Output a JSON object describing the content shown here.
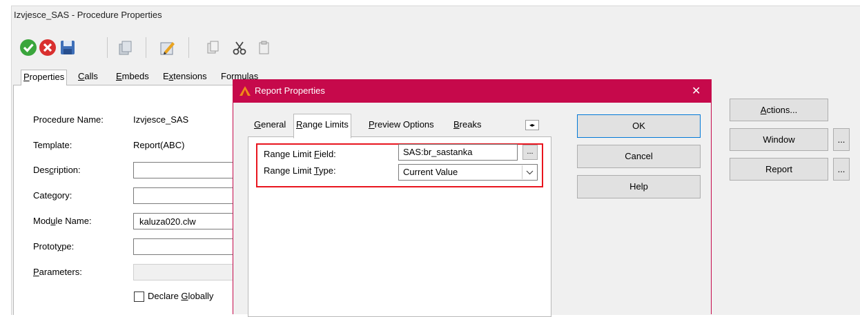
{
  "outer_window": {
    "title": "Izvjesce_SAS - Procedure Properties",
    "tabs": [
      {
        "label": "Properties",
        "ul": "P"
      },
      {
        "label": "Calls",
        "ul": "C"
      },
      {
        "label": "Embeds",
        "ul": "E"
      },
      {
        "label": "Extensions",
        "ul": "x"
      },
      {
        "label": "Formulas",
        "ul": "u"
      }
    ],
    "toolbar": [
      "ok-check-icon",
      "cancel-x-icon",
      "save-disk-icon",
      "copy-pages-icon",
      "edit-pencil-icon",
      "paste-icon",
      "cut-scissors-icon",
      "clipboard-icon"
    ],
    "fields": {
      "procedure_name_label": "Procedure Name:",
      "procedure_name_value": "Izvjesce_SAS",
      "template_label": "Template:",
      "template_value": "Report(ABC)",
      "description_label": "Description:",
      "category_label": "Category:",
      "module_name_label": "Module Name:",
      "module_name_value": "kaluza020.clw",
      "prototype_label": "Prototype:",
      "parameters_label": "Parameters:",
      "declare_globally_label": "Declare Globally"
    },
    "right_buttons": {
      "actions": "Actions...",
      "window": "Window",
      "report": "Report",
      "ellipsis": "..."
    }
  },
  "dialog": {
    "title": "Report Properties",
    "close_glyph": "✕",
    "accent_color": "#c6094b",
    "tabs": [
      "General",
      "Range Limits",
      "Preview Options",
      "Breaks"
    ],
    "active_tab": "Range Limits",
    "range_limit_field_label": "Range Limit Field:",
    "range_limit_field_value": "SAS:br_sastanka",
    "range_limit_type_label": "Range Limit Type:",
    "range_limit_type_value": "Current Value",
    "ellipsis": "...",
    "buttons": {
      "ok": "OK",
      "cancel": "Cancel",
      "help": "Help"
    },
    "highlight_color": "#e8141e"
  }
}
